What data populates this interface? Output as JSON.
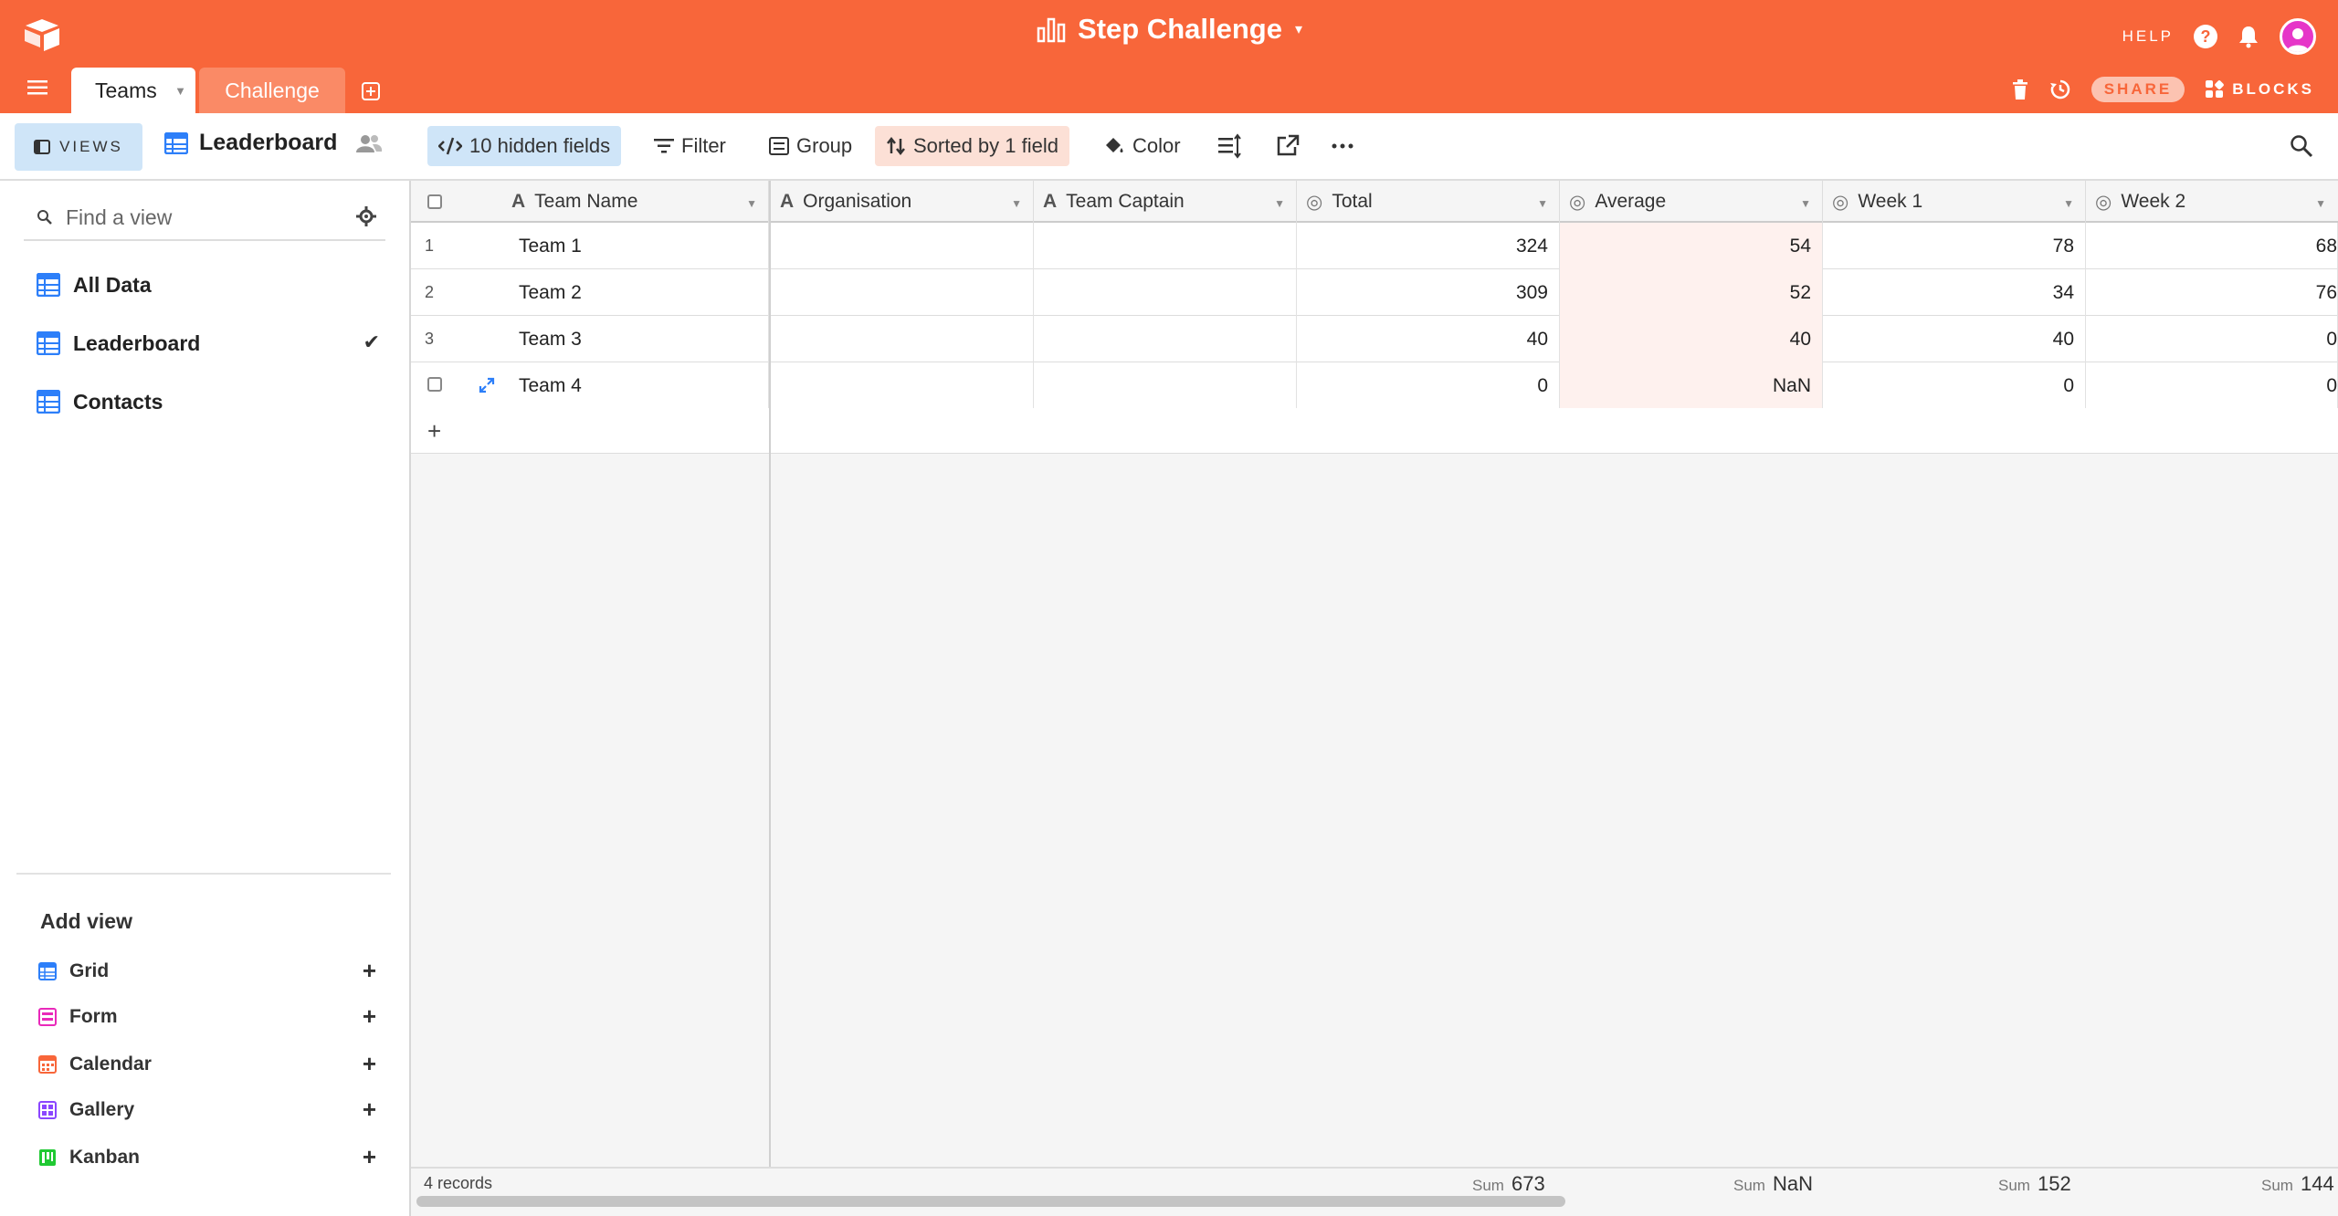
{
  "app": {
    "title": "Step Challenge",
    "accent_color": "#f8663a",
    "help_label": "HELP",
    "share_label": "SHARE",
    "blocks_label": "BLOCKS"
  },
  "tabs": [
    {
      "label": "Teams",
      "active": true
    },
    {
      "label": "Challenge",
      "active": false
    }
  ],
  "toolbar": {
    "views_label": "VIEWS",
    "current_view": "Leaderboard",
    "hidden_fields": "10 hidden fields",
    "filter": "Filter",
    "group": "Group",
    "sort": "Sorted by 1 field",
    "color": "Color"
  },
  "sidebar": {
    "search_placeholder": "Find a view",
    "views": [
      {
        "label": "All Data",
        "selected": false
      },
      {
        "label": "Leaderboard",
        "selected": true
      },
      {
        "label": "Contacts",
        "selected": false
      }
    ],
    "add_view_label": "Add view",
    "add_view_types": [
      {
        "label": "Grid",
        "icon": "grid-icon",
        "color": "#2d7ff9"
      },
      {
        "label": "Form",
        "icon": "form-icon",
        "color": "#e929ba"
      },
      {
        "label": "Calendar",
        "icon": "calendar-icon",
        "color": "#f8663a"
      },
      {
        "label": "Gallery",
        "icon": "gallery-icon",
        "color": "#8b46ff"
      },
      {
        "label": "Kanban",
        "icon": "kanban-icon",
        "color": "#20c933"
      }
    ]
  },
  "grid": {
    "columns": [
      "Team Name",
      "Organisation",
      "Team Captain",
      "Total",
      "Average",
      "Week 1",
      "Week 2"
    ],
    "rows": [
      {
        "num": "1",
        "team": "Team 1",
        "organisation": "",
        "captain": "",
        "total": "324",
        "average": "54",
        "week1": "78",
        "week2": "68"
      },
      {
        "num": "2",
        "team": "Team 2",
        "organisation": "",
        "captain": "",
        "total": "309",
        "average": "52",
        "week1": "34",
        "week2": "76"
      },
      {
        "num": "3",
        "team": "Team 3",
        "organisation": "",
        "captain": "",
        "total": "40",
        "average": "40",
        "week1": "40",
        "week2": "0"
      },
      {
        "num": "",
        "team": "Team 4",
        "organisation": "",
        "captain": "",
        "total": "0",
        "average": "NaN",
        "week1": "0",
        "week2": "0"
      }
    ],
    "add_row": "+",
    "footer": {
      "records": "4 records",
      "sum_label": "Sum",
      "sum_total": "673",
      "sum_average": "NaN",
      "sum_week1": "152",
      "sum_week2": "144"
    }
  }
}
